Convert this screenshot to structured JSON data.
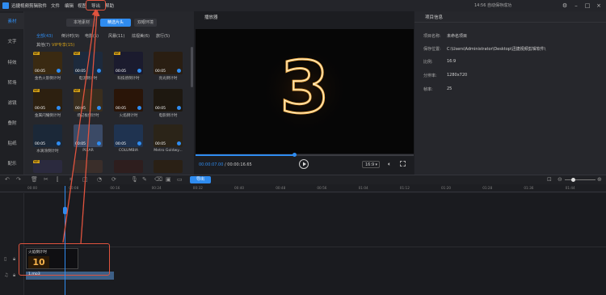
{
  "app": {
    "title": "迅捷视频剪辑软件",
    "save_status": "14:56 自动保存成功"
  },
  "menu": [
    "文件",
    "编辑",
    "视图",
    "导出",
    "帮助"
  ],
  "window_controls": [
    "gear-icon",
    "minimize-icon",
    "maximize-icon",
    "close-icon"
  ],
  "left_nav": [
    "素材",
    "文字",
    "特效",
    "转场",
    "滤镜",
    "叠附",
    "贴纸",
    "配乐"
  ],
  "assets": {
    "tabs": [
      "本地素材",
      "精选片头",
      "双眼环境"
    ],
    "categories_row1": [
      "全部(43)",
      "倒计时(9)",
      "电影(5)",
      "风暴(11)",
      "炫视美(6)",
      "旅行(5)"
    ],
    "categories_row2": [
      "其他(7)",
      "VIP专享(15)"
    ],
    "items": [
      {
        "label": "金色火影倒计时",
        "duration": "00:05",
        "vip": true
      },
      {
        "label": "电流倒计时",
        "duration": "00:05",
        "vip": true
      },
      {
        "label": "科技感倒计时",
        "duration": "00:05",
        "vip": true
      },
      {
        "label": "亮光倒计时",
        "duration": "00:05",
        "vip": false
      },
      {
        "label": "金属闪耀倒计时",
        "duration": "00:05",
        "vip": true
      },
      {
        "label": "场记板倒计时",
        "duration": "00:05",
        "vip": true
      },
      {
        "label": "火焰倒计时",
        "duration": "00:05",
        "vip": false
      },
      {
        "label": "电影倒计时",
        "duration": "00:05",
        "vip": false
      },
      {
        "label": "水滴涂倒计时",
        "duration": "00:05",
        "vip": false
      },
      {
        "label": "PIXAR",
        "duration": "00:05",
        "vip": false
      },
      {
        "label": "COLUMBIA",
        "duration": "00:05",
        "vip": false
      },
      {
        "label": "Metro Goldwy...",
        "duration": "00:05",
        "vip": false
      },
      {
        "label": "",
        "duration": "",
        "vip": true
      },
      {
        "label": "",
        "duration": "",
        "vip": false
      },
      {
        "label": "",
        "duration": "",
        "vip": false
      },
      {
        "label": "",
        "duration": "",
        "vip": false
      }
    ]
  },
  "player": {
    "title": "播放器",
    "preview_digit": "3",
    "current_time": "00:00:07.00",
    "total_time": "/ 00:00:16.65",
    "progress": 0.45,
    "ratio": "16:9"
  },
  "project_info": {
    "title": "项目信息",
    "rows": [
      {
        "key": "项目名称:",
        "value": "未命名项目"
      },
      {
        "key": "保存位置:",
        "value": "C:\\Users\\Administrator\\Desktop\\迅捷视频剪辑软件\\"
      },
      {
        "key": "比例:",
        "value": "16:9"
      },
      {
        "key": "分辨率:",
        "value": "1280x720"
      },
      {
        "key": "帧率:",
        "value": "25"
      }
    ]
  },
  "toolbar": {
    "export_label": "导出"
  },
  "ruler_ticks": [
    "00:00",
    "00:08",
    "00:16",
    "00:24",
    "00:32",
    "00:40",
    "00:48",
    "00:56",
    "01:04",
    "01:12",
    "01:20",
    "01:28",
    "01:36",
    "01:44"
  ],
  "timeline": {
    "clip_label": "火焰倒计时",
    "clip_number": "10",
    "audio_label": "1.mp3"
  },
  "colors": {
    "accent": "#2f8cf0",
    "annotation": "#e0533e",
    "vip": "#d4a017"
  }
}
